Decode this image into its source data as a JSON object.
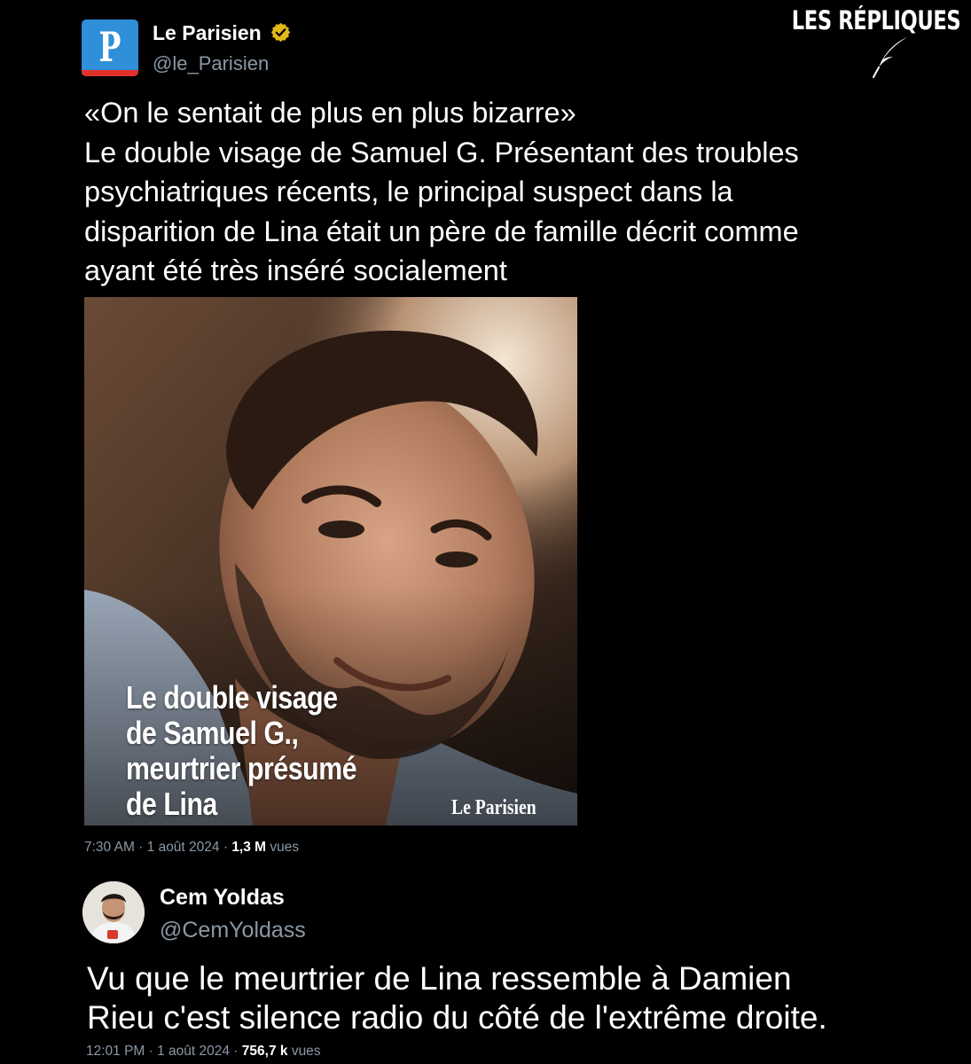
{
  "watermark": {
    "text": "LES RÉPLIQUES",
    "icon": "quill-icon"
  },
  "tweet1": {
    "avatar_icon": "le-parisien-logo",
    "avatar_letter": "P",
    "display_name": "Le Parisien",
    "verified_icon": "verified-badge-icon",
    "verified_color": "#e2b719",
    "handle": "@le_Parisien",
    "text_lines": [
      "«On le sentait de plus en plus bizarre»",
      "Le double visage de Samuel G. Présentant des troubles",
      "psychiatriques récents, le principal suspect dans la",
      "disparition de Lina était un père de famille décrit comme",
      "ayant été très inséré socialement"
    ],
    "image": {
      "caption_lines": [
        "Le double visage",
        "de Samuel G.,",
        "meurtrier présumé",
        "de Lina"
      ],
      "logo_text": "Le Parisien"
    },
    "meta": {
      "time_date": "7:30 AM · 1 août 2024 ·",
      "views_count": "1,3 M",
      "views_label": "vues"
    }
  },
  "tweet2": {
    "avatar_icon": "profile-photo",
    "display_name": "Cem Yoldas",
    "handle": "@CemYoldass",
    "text_lines": [
      "Vu que le meurtrier de Lina ressemble à Damien",
      "Rieu c'est silence radio du côté de l'extrême droite."
    ],
    "meta": {
      "time_date": "12:01 PM · 1 août 2024 ·",
      "views_count": "756,7 k",
      "views_label": "vues"
    }
  },
  "colors": {
    "background": "#000000",
    "text_primary": "#ffffff",
    "text_secondary": "#8b98a5",
    "le_parisien_blue": "#2f8fd8",
    "le_parisien_red": "#e1312b"
  }
}
